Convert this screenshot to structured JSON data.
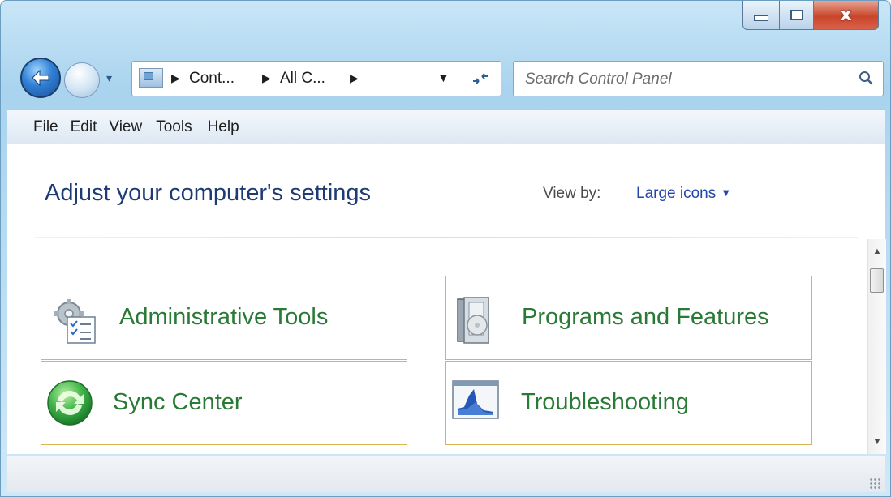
{
  "window": {
    "caption_buttons": {
      "minimize": "minimize",
      "maximize": "maximize",
      "close": "x"
    }
  },
  "nav": {
    "breadcrumbs": [
      "Cont...",
      "All C..."
    ],
    "refresh_icon": "refresh-icon"
  },
  "search": {
    "placeholder": "Search Control Panel",
    "value": ""
  },
  "menu": [
    "File",
    "Edit",
    "View",
    "Tools",
    "Help"
  ],
  "content": {
    "heading": "Adjust your computer's settings",
    "view_by_label": "View by:",
    "view_by_value": "Large icons",
    "items": [
      {
        "label": "Administrative Tools",
        "icon": "administrative-tools-icon"
      },
      {
        "label": "Programs and Features",
        "icon": "programs-features-icon"
      },
      {
        "label": "Sync Center",
        "icon": "sync-center-icon"
      },
      {
        "label": "Troubleshooting",
        "icon": "troubleshooting-icon"
      }
    ]
  },
  "colors": {
    "accent_link": "#2346a8",
    "item_label": "#2a7a37",
    "item_border": "#d9b552",
    "heading": "#1f3b74"
  }
}
